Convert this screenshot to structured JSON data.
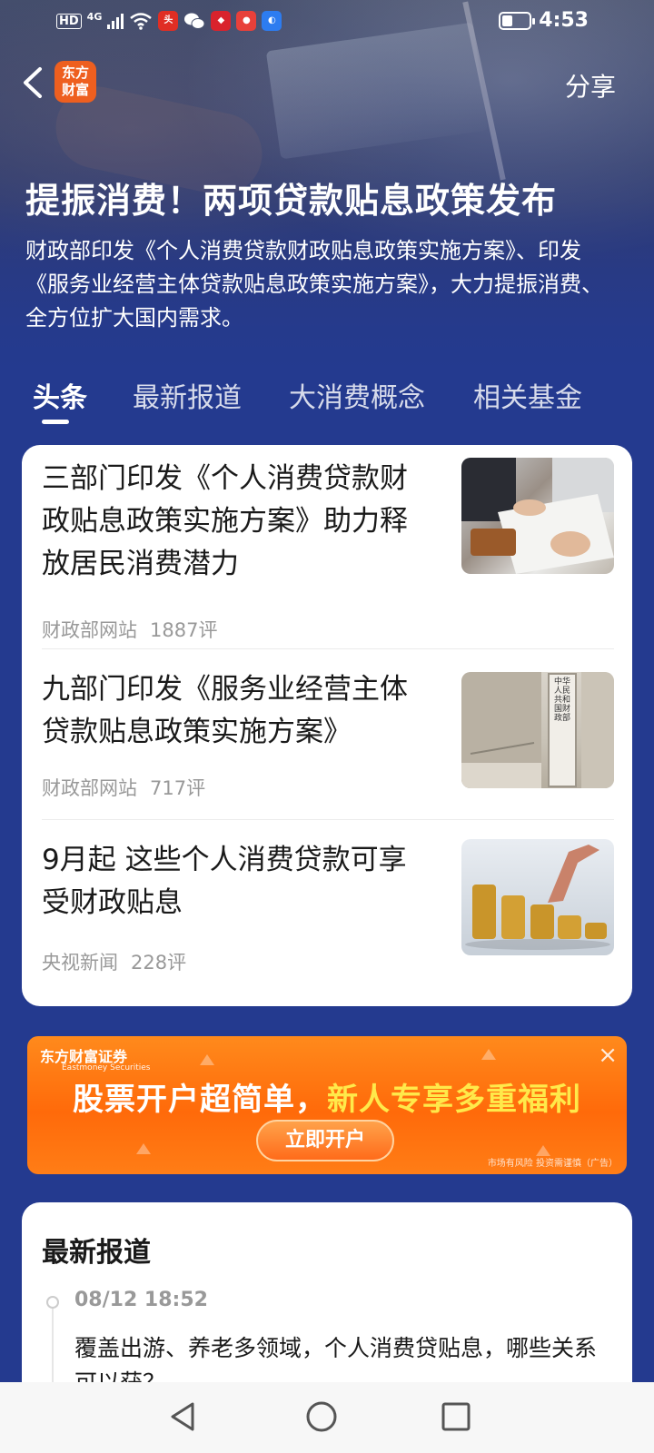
{
  "status_bar": {
    "network_badge": "HD",
    "network_type": "4G",
    "time": "4:53",
    "battery_level": 0.4
  },
  "header": {
    "logo_text_line1": "东方",
    "logo_text_line2": "财富",
    "share_label": "分享"
  },
  "hero": {
    "title": "提振消费！两项贷款贴息政策发布",
    "description": "财政部印发《个人消费贷款财政贴息政策实施方案》、印发《服务业经营主体贷款贴息政策实施方案》，大力提振消费、全方位扩大国内需求。"
  },
  "tabs": [
    {
      "label": "头条"
    },
    {
      "label": "最新报道"
    },
    {
      "label": "大消费概念"
    },
    {
      "label": "相关基金"
    }
  ],
  "news": [
    {
      "title": "三部门印发《个人消费贷款财政贴息政策实施方案》助力释放居民消费潜力",
      "source": "财政部网站",
      "comments": "1887评"
    },
    {
      "title": "九部门印发《服务业经营主体贷款贴息政策实施方案》",
      "source": "财政部网站",
      "comments": "717评",
      "thumb_sign": "中华人民共和国财政部"
    },
    {
      "title": "9月起 这些个人消费贷款可享受财政贴息",
      "source": "央视新闻",
      "comments": "228评"
    }
  ],
  "ad": {
    "brand": "东方财富证券",
    "brand_sub": "Eastmoney Securities",
    "slogan_part1": "股票开户超简单，",
    "slogan_part2": "新人专享多重福利",
    "button_label": "立即开户",
    "risk_note": "市场有风险 投资需谨慎（广告）",
    "close_icon": "×"
  },
  "latest": {
    "heading": "最新报道",
    "items": [
      {
        "time": "08/12 18:52",
        "text": "覆盖出游、养老多领域，个人消费贷贴息，哪些关系可以获？"
      }
    ]
  },
  "colors": {
    "page_bg": "#243a8f",
    "brand_orange": "#ee5f1f",
    "ad_orange": "#ff6a0a",
    "ad_highlight": "#ffe94a"
  }
}
